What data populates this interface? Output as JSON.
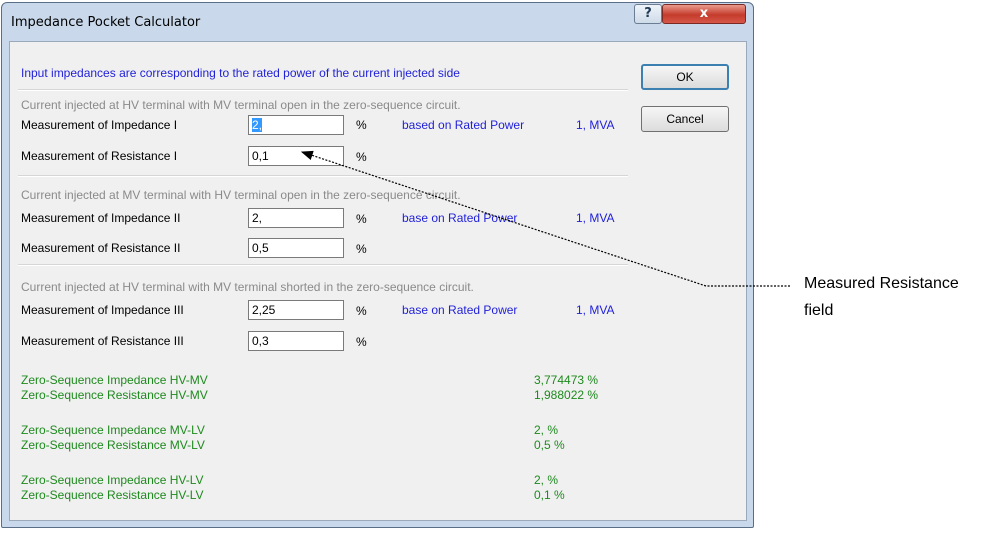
{
  "window": {
    "title": "Impedance Pocket Calculator",
    "help_label": "?",
    "close_label": "x"
  },
  "info_text": "Input impedances are corresponding to the rated power of the current injected side",
  "buttons": {
    "ok": "OK",
    "cancel": "Cancel"
  },
  "sections": [
    {
      "heading": "Current injected at HV terminal with MV terminal open in the zero-sequence circuit.",
      "impedance_label": "Measurement of Impedance I",
      "impedance_value": "2,",
      "impedance_unit": "%",
      "basis_label": "based on Rated Power",
      "basis_value": "1, MVA",
      "resistance_label": "Measurement of Resistance I",
      "resistance_value": "0,1",
      "resistance_unit": "%"
    },
    {
      "heading": "Current injected at MV terminal with HV terminal open in the zero-sequence circuit.",
      "impedance_label": "Measurement of Impedance II",
      "impedance_value": "2,",
      "impedance_unit": "%",
      "basis_label": "base on Rated Power",
      "basis_value": "1, MVA",
      "resistance_label": "Measurement of Resistance II",
      "resistance_value": "0,5",
      "resistance_unit": "%"
    },
    {
      "heading": "Current injected at HV terminal with MV terminal shorted in the zero-sequence circuit.",
      "impedance_label": "Measurement of Impedance III",
      "impedance_value": "2,25",
      "impedance_unit": "%",
      "basis_label": "base on Rated Power",
      "basis_value": "1, MVA",
      "resistance_label": "Measurement of Resistance III",
      "resistance_value": "0,3",
      "resistance_unit": "%"
    }
  ],
  "results": [
    {
      "label": "Zero-Sequence Impedance HV-MV",
      "value": "3,774473 %"
    },
    {
      "label": "Zero-Sequence Resistance HV-MV",
      "value": "1,988022 %"
    },
    {
      "label": "Zero-Sequence Impedance MV-LV",
      "value": "2, %"
    },
    {
      "label": "Zero-Sequence Resistance MV-LV",
      "value": "0,5 %"
    },
    {
      "label": "Zero-Sequence Impedance HV-LV",
      "value": "2, %"
    },
    {
      "label": "Zero-Sequence Resistance HV-LV",
      "value": "0,1 %"
    }
  ],
  "annotation": {
    "line1": "Measured Resistance",
    "line2": "field"
  },
  "colors": {
    "info_text": "#1f1fd8",
    "heading_text": "#8a8a8a",
    "result_text": "#1e8a1e",
    "close_button": "#c43b2b"
  }
}
